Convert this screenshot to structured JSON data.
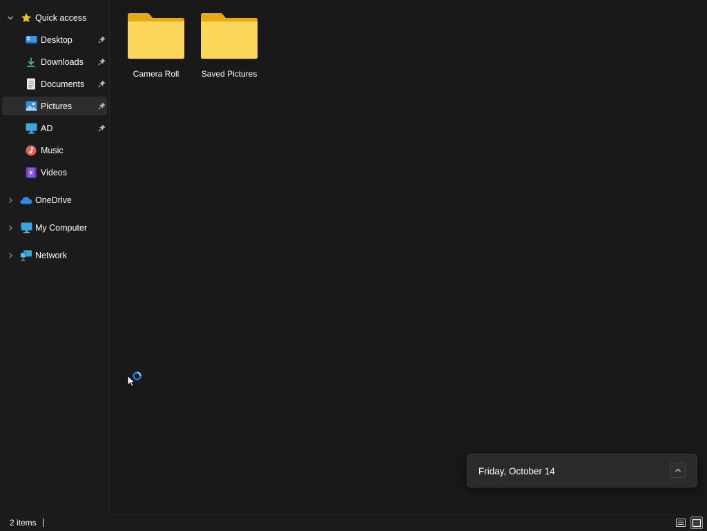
{
  "sidebar": {
    "quick_access": "Quick access",
    "items": [
      {
        "label": "Desktop",
        "icon": "desktop-icon",
        "pinned": true
      },
      {
        "label": "Downloads",
        "icon": "downloads-icon",
        "pinned": true
      },
      {
        "label": "Documents",
        "icon": "documents-icon",
        "pinned": true
      },
      {
        "label": "Pictures",
        "icon": "pictures-icon",
        "pinned": true,
        "selected": true
      },
      {
        "label": "AD",
        "icon": "monitor-icon",
        "pinned": true
      },
      {
        "label": "Music",
        "icon": "music-icon",
        "pinned": false
      },
      {
        "label": "Videos",
        "icon": "videos-icon",
        "pinned": false
      }
    ],
    "onedrive": "OneDrive",
    "my_computer": "My Computer",
    "network": "Network"
  },
  "content": {
    "folders": [
      {
        "name": "Camera Roll",
        "icon": "folder-icon"
      },
      {
        "name": "Saved Pictures",
        "icon": "folder-icon"
      }
    ]
  },
  "notification": {
    "date": "Friday, October 14"
  },
  "statusbar": {
    "item_count": "2 items"
  },
  "colors": {
    "background": "#191919",
    "sidebar": "#1b1b1b",
    "selected": "#2d2d2d",
    "folder_yellow": "#f8c948",
    "accent": "#3a96dd"
  }
}
